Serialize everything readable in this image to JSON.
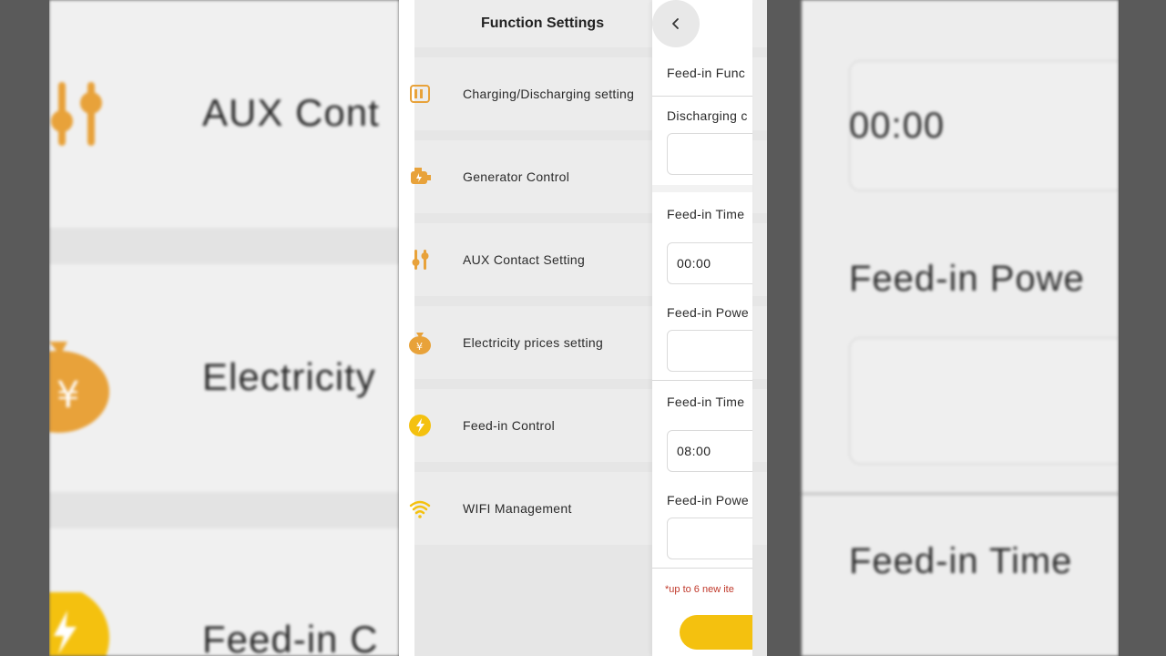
{
  "header": {
    "title": "Function Settings"
  },
  "menu": [
    {
      "label": "Charging/Discharging setting",
      "icon": "battery-icon"
    },
    {
      "label": "Generator Control",
      "icon": "generator-icon"
    },
    {
      "label": "AUX Contact Setting",
      "icon": "sliders-icon"
    },
    {
      "label": "Electricity prices setting",
      "icon": "money-bag-icon"
    },
    {
      "label": "Feed-in Control",
      "icon": "lightning-icon"
    },
    {
      "label": "WIFI Management",
      "icon": "wifi-icon"
    }
  ],
  "detail": {
    "feed_in_function_label": "Feed-in Func",
    "discharging_label": "Discharging c",
    "time1_label": "Feed-in Time",
    "time1_value": "00:00",
    "power1_label": "Feed-in Powe",
    "time2_label": "Feed-in Time",
    "time2_value": "08:00",
    "power2_label": "Feed-in Powe",
    "note": "*up to 6 new ite"
  },
  "background": {
    "left_text_1": "AUX Cont",
    "left_text_2": "Electricity",
    "left_text_3": "Feed-in C",
    "right_value": "00:00",
    "right_label_1": "Feed-in Powe",
    "right_label_2": "Feed-in Time"
  },
  "colors": {
    "accent": "#F4C10F",
    "icon_orange": "#E8A23A",
    "note_red": "#C0392B"
  }
}
